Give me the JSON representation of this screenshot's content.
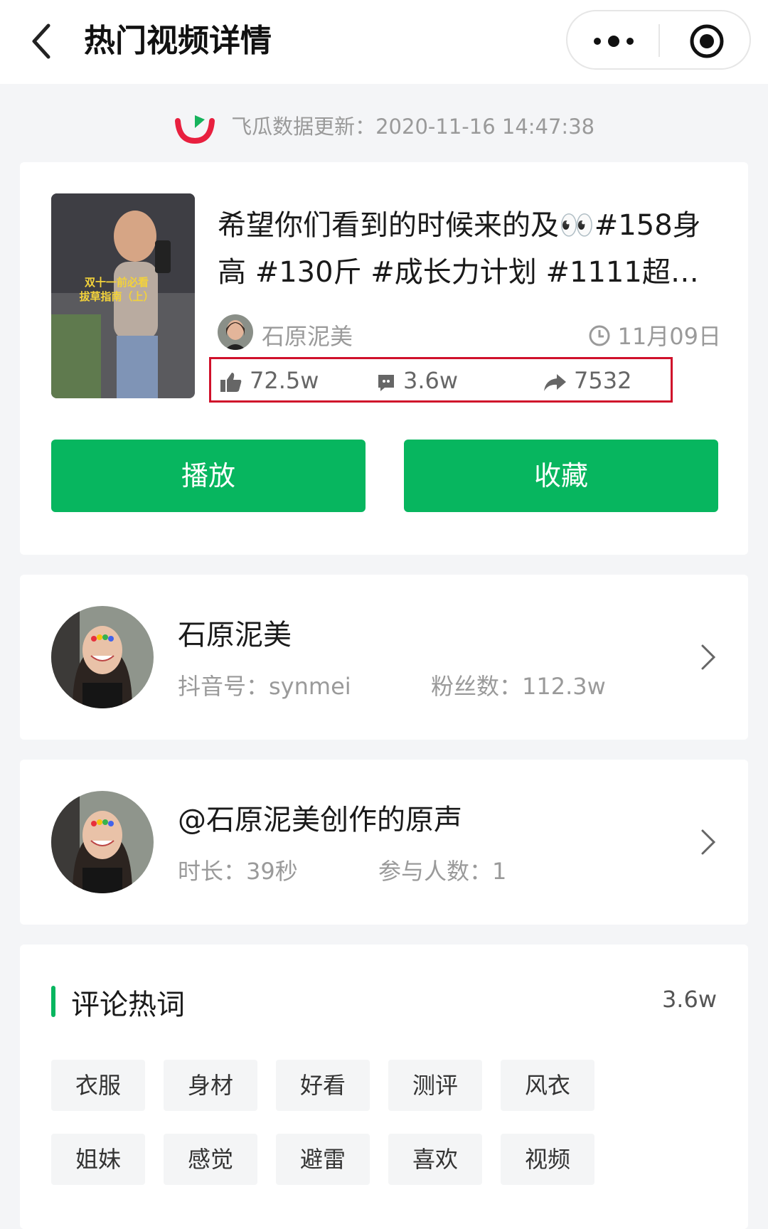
{
  "header": {
    "title": "热门视频详情"
  },
  "update": {
    "text": "飞瓜数据更新：2020-11-16 14:47:38"
  },
  "video": {
    "title": "希望你们看到的时候来的及👀#158身高 #130斤 #成长力计划 #1111超级…",
    "thumb_caption_line1": "双十一前必看",
    "thumb_caption_line2": "拔草指南（上）",
    "author": "石原泥美",
    "date": "11月09日",
    "likes": "72.5w",
    "comments": "3.6w",
    "shares": "7532",
    "play_label": "播放",
    "fav_label": "收藏"
  },
  "creator": {
    "name": "石原泥美",
    "douyin_id": "抖音号：synmei",
    "fans": "粉丝数：112.3w"
  },
  "music": {
    "name": "@石原泥美创作的原声",
    "duration": "时长：39秒",
    "participants": "参与人数：1"
  },
  "comments_section": {
    "title": "评论热词",
    "count": "3.6w",
    "tags": [
      "衣服",
      "身材",
      "好看",
      "测评",
      "风衣",
      "姐妹",
      "感觉",
      "避雷",
      "喜欢",
      "视频"
    ]
  },
  "colors": {
    "accent": "#07b65f",
    "highlight_box": "#d0112b",
    "muted_text": "#9a9a9a"
  }
}
